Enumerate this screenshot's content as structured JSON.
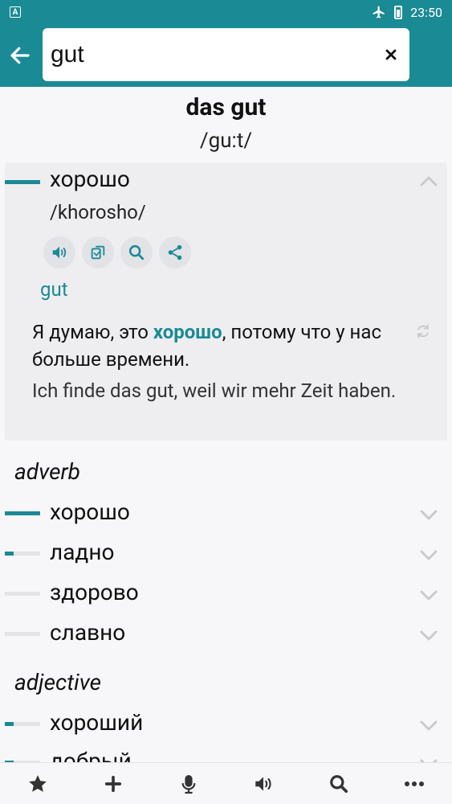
{
  "status_bar": {
    "app_badge": "A",
    "time": "23:50"
  },
  "search": {
    "query": "gut",
    "placeholder": ""
  },
  "entry": {
    "headword": "das gut",
    "pronunciation": "/gu:t/",
    "expanded": {
      "translation": "хорошо",
      "frequency": 1.0,
      "transliteration": "/khorosho/",
      "source_word": "gut",
      "example_before": "Я думаю, это ",
      "example_highlight": "хорошо",
      "example_after": ", потому что у нас больше времени.",
      "example_translation": "Ich finde das gut, weil wir mehr Zeit haben."
    },
    "sections": [
      {
        "pos": "adverb",
        "items": [
          {
            "word": "хорошо",
            "frequency": 1.0
          },
          {
            "word": "ладно",
            "frequency": 0.25
          },
          {
            "word": "здорово",
            "frequency": 0.0
          },
          {
            "word": "славно",
            "frequency": 0.0
          }
        ]
      },
      {
        "pos": "adjective",
        "items": [
          {
            "word": "хороший",
            "frequency": 0.25
          },
          {
            "word": "добрый",
            "frequency": 0.25
          }
        ]
      }
    ]
  },
  "icons": {
    "back": "arrow-left-icon",
    "clear": "close-icon",
    "speak": "speaker-icon",
    "copy": "copy-icon",
    "search": "search-icon",
    "share": "share-icon",
    "refresh": "refresh-icon",
    "chevron_up": "chevron-up-icon",
    "chevron_down": "chevron-down-icon"
  },
  "bottom_nav": [
    "star-icon",
    "plus-icon",
    "microphone-icon",
    "speaker-icon",
    "search-icon",
    "more-icon"
  ],
  "colors": {
    "accent": "#1a8a95",
    "text": "#111111",
    "background": "#f7f7f9",
    "card": "#eeeef1"
  }
}
